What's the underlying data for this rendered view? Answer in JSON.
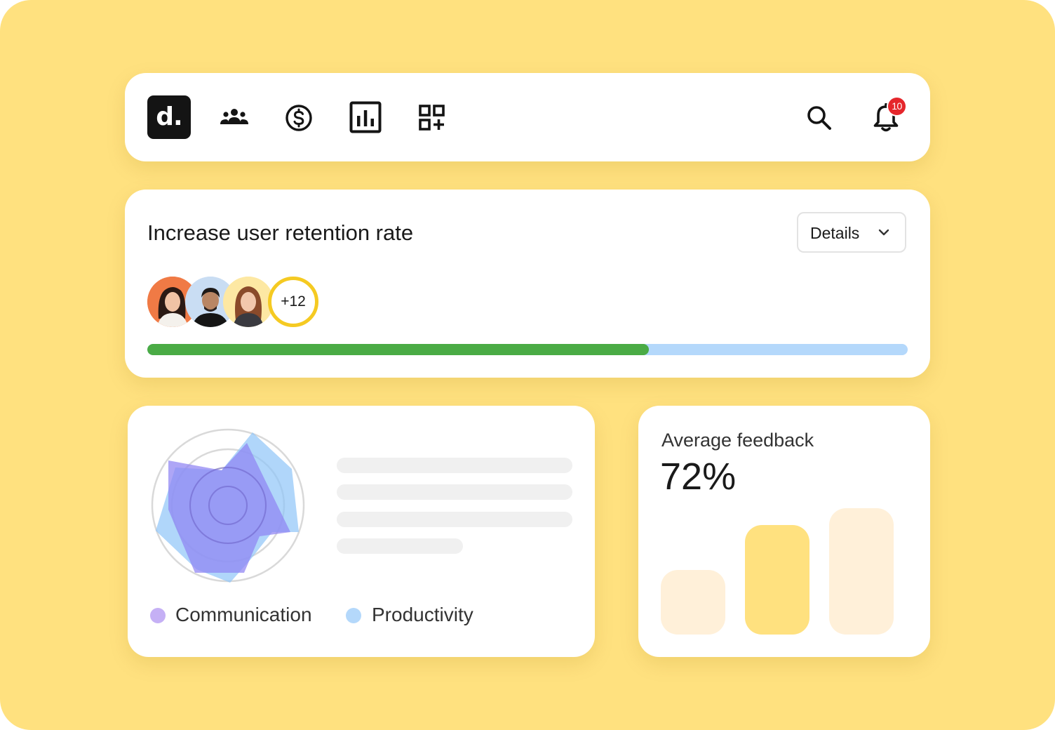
{
  "nav": {
    "logo_text": "d.",
    "icons": [
      "team-icon",
      "dollar-icon",
      "bar-chart-icon",
      "apps-add-icon"
    ],
    "notifications_count": "10"
  },
  "goal": {
    "title": "Increase user retention rate",
    "details_label": "Details",
    "extra_members": "+12",
    "progress": 0.66
  },
  "radar": {
    "legend": [
      {
        "label": "Communication",
        "color": "#C5B0F5"
      },
      {
        "label": "Productivity",
        "color": "#B4D8FB"
      }
    ]
  },
  "feedback": {
    "title": "Average feedback",
    "value": "72%"
  },
  "colors": {
    "background": "#FFE17F",
    "progress_fill": "#4AAB45",
    "progress_track": "#B4D8FB",
    "bar_muted": "#FFF0D9",
    "bar_active": "#FFE17F",
    "badge": "#E5262B"
  }
}
